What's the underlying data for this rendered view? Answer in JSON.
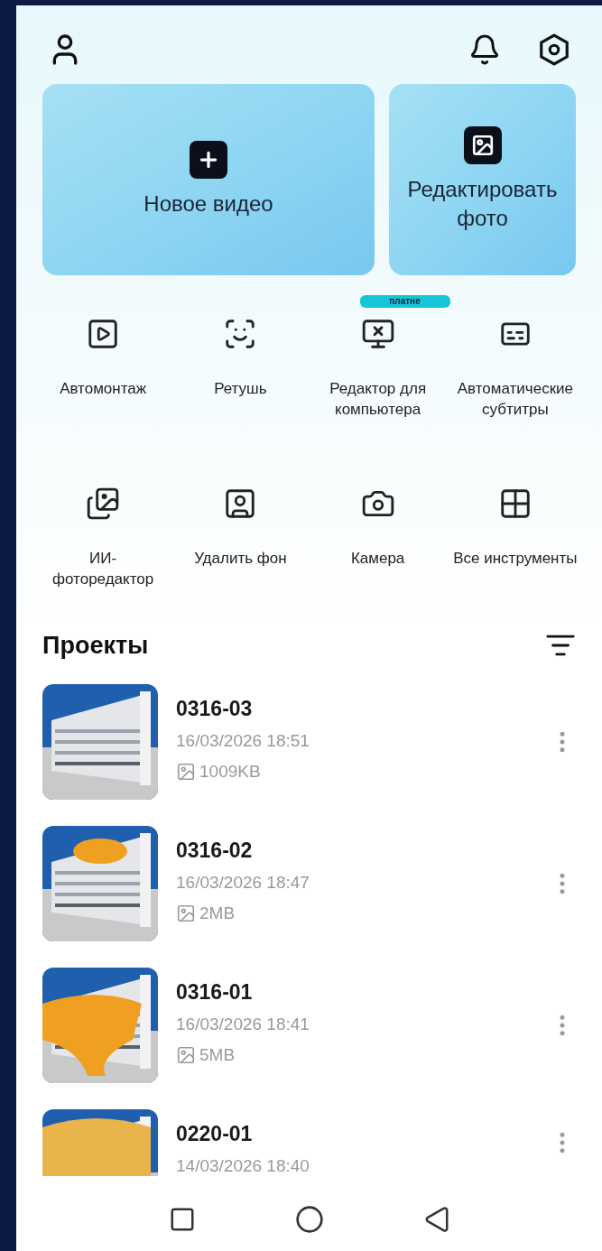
{
  "actions": [
    {
      "label": "Новое видео",
      "kind": "new"
    },
    {
      "label": "Редактировать фото"
    }
  ],
  "tools": [
    {
      "label": "Автомонтаж"
    },
    {
      "label": "Ретушь"
    },
    {
      "label": "Редактор для компьютера",
      "badge": "платне"
    },
    {
      "label": "Автоматические субтитры"
    },
    {
      "label": "ИИ-фоторедактор"
    },
    {
      "label": "Удалить фон"
    },
    {
      "label": "Камера"
    },
    {
      "label": "Все инструменты"
    }
  ],
  "projects": {
    "title": "Проекты",
    "items": [
      {
        "name": "0316-03",
        "date": "16/03/2026 18:51",
        "size": "1009KB"
      },
      {
        "name": "0316-02",
        "date": "16/03/2026 18:47",
        "size": "2MB"
      },
      {
        "name": "0316-01",
        "date": "16/03/2026 18:41",
        "size": "5MB"
      },
      {
        "name": "0220-01",
        "date": "14/03/2026 18:40"
      }
    ]
  }
}
